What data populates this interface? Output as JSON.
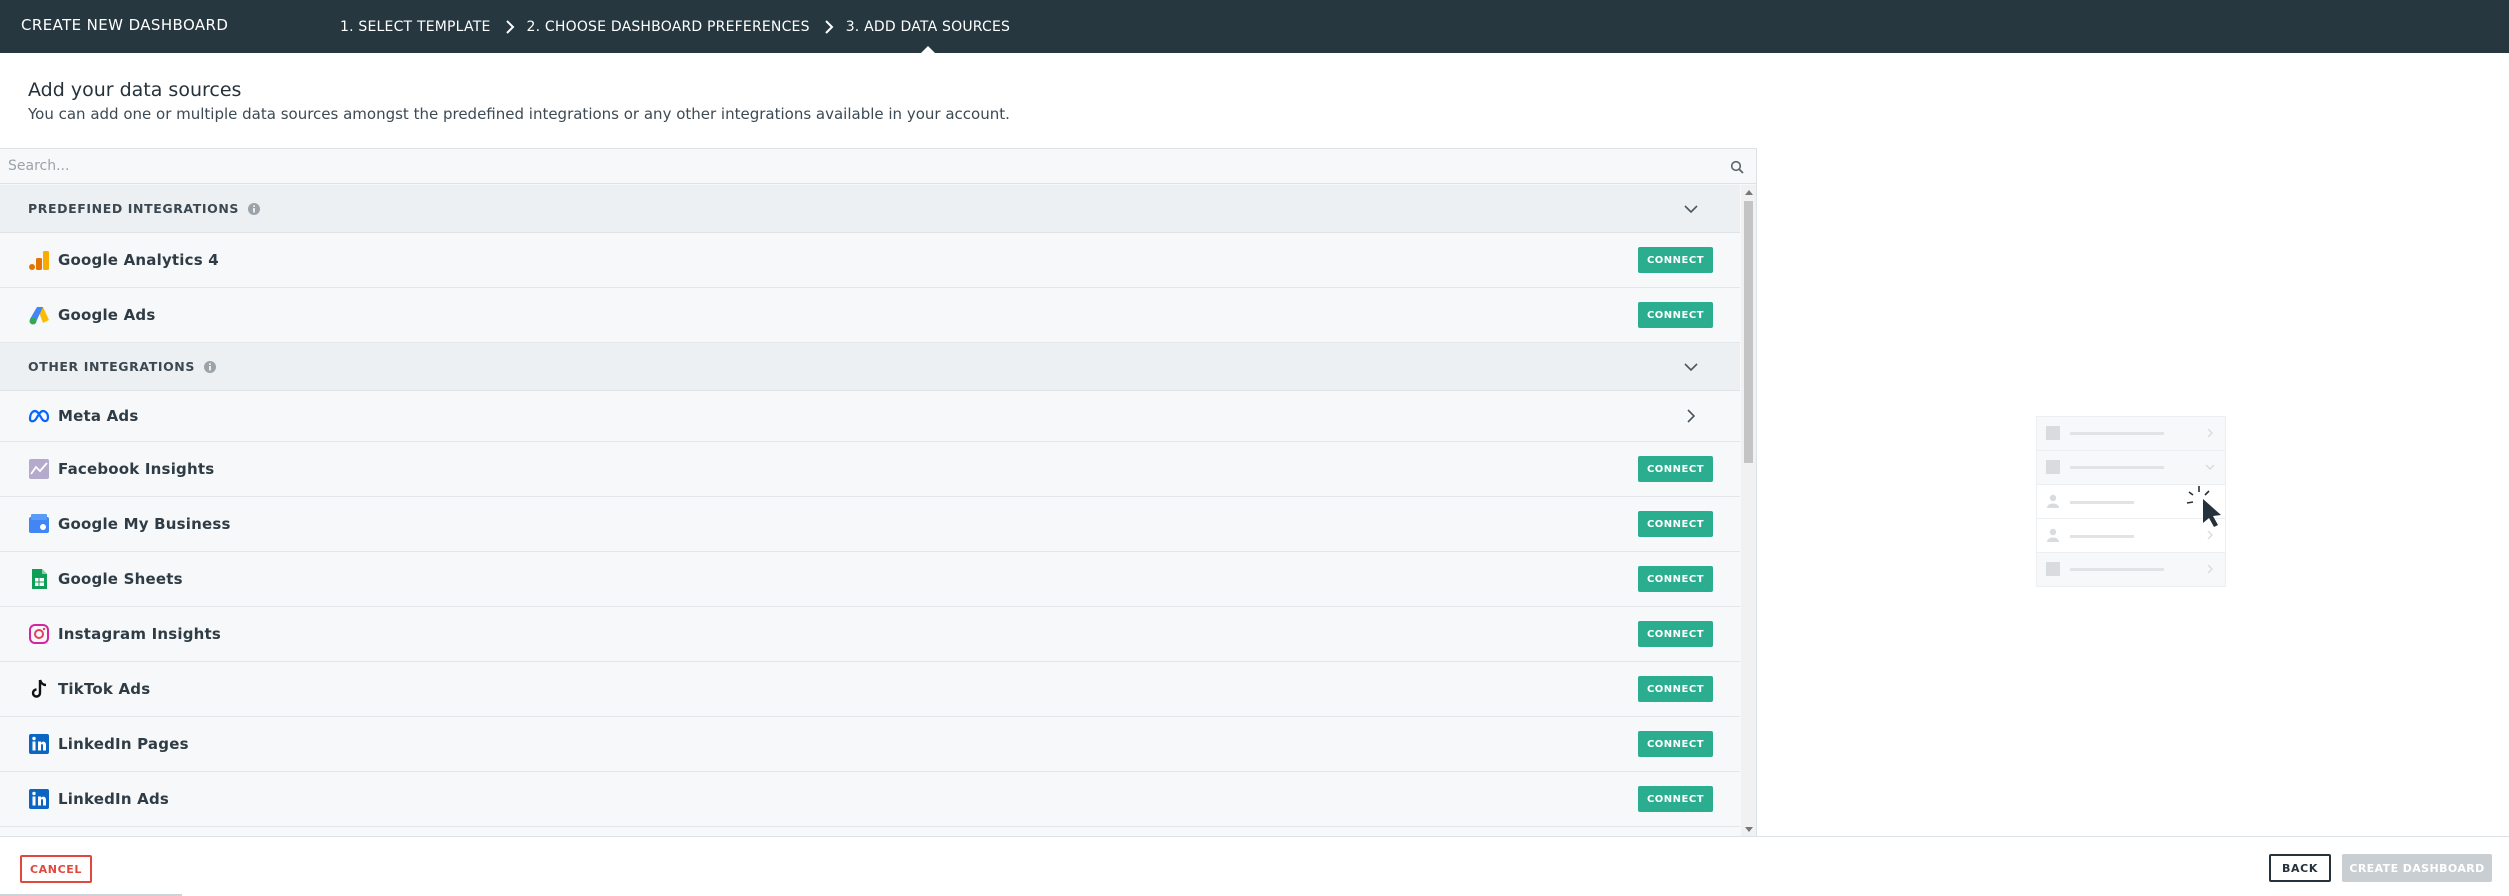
{
  "header": {
    "title": "CREATE NEW DASHBOARD",
    "steps": [
      {
        "label": "1. SELECT TEMPLATE"
      },
      {
        "label": "2. CHOOSE DASHBOARD PREFERENCES"
      },
      {
        "label": "3. ADD DATA SOURCES",
        "active": true
      }
    ]
  },
  "page": {
    "title": "Add your data sources",
    "subtitle": "You can add one or multiple data sources amongst the predefined integrations or any other integrations available in your account."
  },
  "search": {
    "placeholder": "Search...",
    "value": "",
    "icon": "search-icon"
  },
  "sections": {
    "predefined": {
      "label": "PREDEFINED INTEGRATIONS",
      "items": [
        {
          "name": "Google Analytics 4",
          "icon": "google-analytics-icon",
          "action": "CONNECT"
        },
        {
          "name": "Google Ads",
          "icon": "google-ads-icon",
          "action": "CONNECT"
        }
      ]
    },
    "other": {
      "label": "OTHER INTEGRATIONS",
      "items": [
        {
          "name": "Meta Ads",
          "icon": "meta-icon",
          "action": ""
        },
        {
          "name": "Facebook Insights",
          "icon": "facebook-insights-icon",
          "action": "CONNECT"
        },
        {
          "name": "Google My Business",
          "icon": "google-my-business-icon",
          "action": "CONNECT"
        },
        {
          "name": "Google Sheets",
          "icon": "google-sheets-icon",
          "action": "CONNECT"
        },
        {
          "name": "Instagram Insights",
          "icon": "instagram-icon",
          "action": "CONNECT"
        },
        {
          "name": "TikTok Ads",
          "icon": "tiktok-icon",
          "action": "CONNECT"
        },
        {
          "name": "LinkedIn Pages",
          "icon": "linkedin-icon",
          "action": "CONNECT"
        },
        {
          "name": "LinkedIn Ads",
          "icon": "linkedin-icon",
          "action": "CONNECT"
        }
      ]
    }
  },
  "footer": {
    "cancel_label": "CANCEL",
    "back_label": "BACK",
    "create_label": "CREATE DASHBOARD"
  },
  "colors": {
    "header_bg": "#263740",
    "connect_green": "#2aae8f",
    "cancel_red": "#e0483e",
    "disabled_gray": "#c9ced2"
  }
}
